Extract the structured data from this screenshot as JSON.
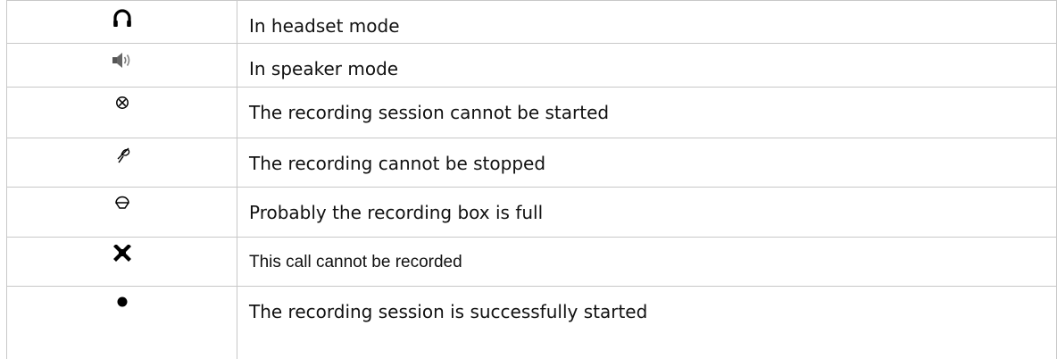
{
  "rows": [
    {
      "icon": "headset-icon",
      "text": "In headset mode"
    },
    {
      "icon": "speaker-icon",
      "text": "In speaker mode"
    },
    {
      "icon": "circle-x-icon",
      "text": "The recording session cannot be started"
    },
    {
      "icon": "crossed-mic-icon",
      "text": "The recording cannot be stopped"
    },
    {
      "icon": "recording-box-full-icon",
      "text": "Probably the recording box is full"
    },
    {
      "icon": "bold-x-icon",
      "text": "This call cannot be recorded"
    },
    {
      "icon": "filled-dot-icon",
      "text": "The recording session is successfully started"
    }
  ]
}
